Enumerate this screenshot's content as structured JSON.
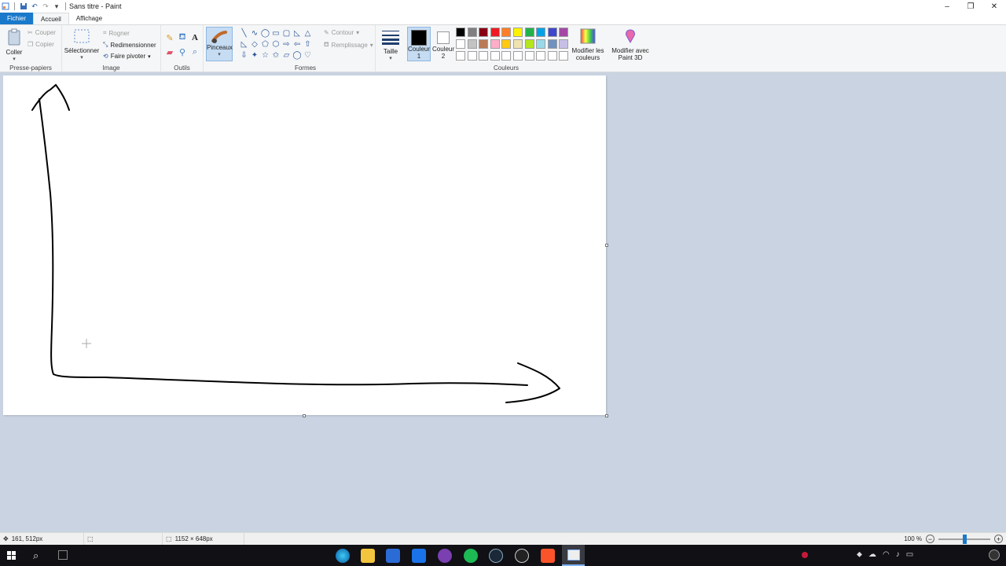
{
  "window": {
    "title": "Sans titre - Paint",
    "controls": {
      "minimize": "–",
      "maximize": "❐",
      "close": "✕"
    }
  },
  "tabs": {
    "file": "Fichier",
    "home": "Accueil",
    "view": "Affichage"
  },
  "ribbon": {
    "clipboard": {
      "group_label": "Presse-papiers",
      "paste": "Coller",
      "cut": "Couper",
      "copy": "Copier"
    },
    "image": {
      "group_label": "Image",
      "select": "Sélectionner",
      "crop": "Rogner",
      "resize": "Redimensionner",
      "rotate": "Faire pivoter"
    },
    "tools": {
      "group_label": "Outils"
    },
    "brushes": {
      "label": "Pinceaux"
    },
    "shapes": {
      "group_label": "Formes",
      "outline": "Contour",
      "fill": "Remplissage"
    },
    "size": {
      "label": "Taille"
    },
    "colors": {
      "group_label": "Couleurs",
      "color1": "Couleur 1",
      "color2": "Couleur 2",
      "color1_value": "#000000",
      "color2_value": "#ffffff",
      "edit_colors": "Modifier les couleurs",
      "palette_row1": [
        "#000000",
        "#7f7f7f",
        "#880015",
        "#ed1c24",
        "#ff7f27",
        "#fff200",
        "#22b14c",
        "#00a2e8",
        "#3f48cc",
        "#a349a4"
      ],
      "palette_row2": [
        "#ffffff",
        "#c3c3c3",
        "#b97a57",
        "#ffaec9",
        "#ffc90e",
        "#efe4b0",
        "#b5e61d",
        "#99d9ea",
        "#7092be",
        "#c8bfe7"
      ],
      "palette_row3": [
        "#ffffff",
        "#ffffff",
        "#ffffff",
        "#ffffff",
        "#ffffff",
        "#ffffff",
        "#ffffff",
        "#ffffff",
        "#ffffff",
        "#ffffff"
      ]
    },
    "paint3d": {
      "label": "Modifier avec Paint 3D"
    }
  },
  "status": {
    "cursor_position": "161, 512px",
    "canvas_size": "1152 × 648px",
    "zoom": "100 %",
    "zoom_level": 0.5
  }
}
